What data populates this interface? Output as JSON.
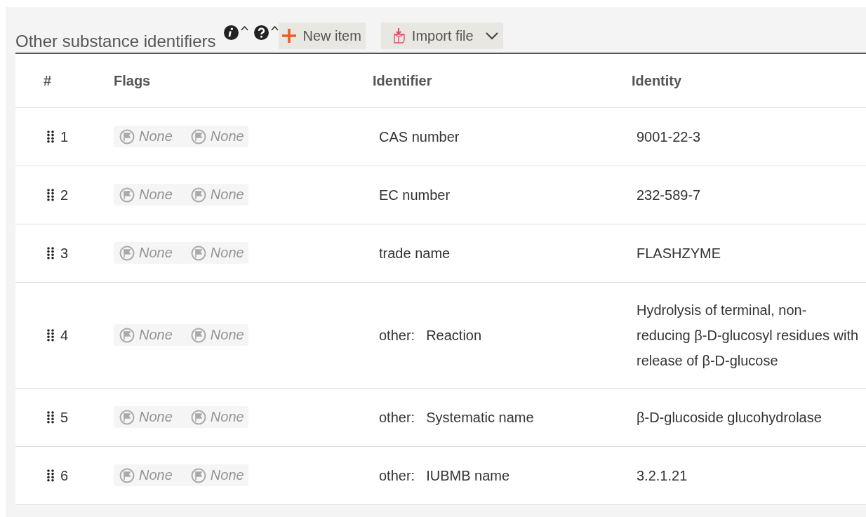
{
  "section": {
    "title": "Other substance identifiers"
  },
  "toolbar": {
    "new_item": "New item",
    "import_file": "Import file"
  },
  "table": {
    "columns": [
      "#",
      "Flags",
      "Identifier",
      "Identity"
    ],
    "rows": [
      {
        "number": "1",
        "flags": [
          {
            "label": "None",
            "disabled": true
          },
          {
            "label": "None",
            "disabled": true
          }
        ],
        "identifier": {
          "name": "CAS number"
        },
        "identity": "9001-22-3"
      },
      {
        "number": "2",
        "flags": [
          {
            "label": "None",
            "disabled": true
          },
          {
            "label": "None",
            "disabled": true
          }
        ],
        "identifier": {
          "name": "EC number"
        },
        "identity": "232-589-7"
      },
      {
        "number": "3",
        "flags": [
          {
            "label": "None",
            "disabled": true
          },
          {
            "label": "None",
            "disabled": true
          }
        ],
        "identifier": {
          "name": "trade name"
        },
        "identity": "FLASHZYME"
      },
      {
        "number": "4",
        "flags": [
          {
            "label": "None",
            "disabled": true
          },
          {
            "label": "None",
            "disabled": true
          }
        ],
        "identifier": {
          "qualifier": "other:",
          "name": "Reaction"
        },
        "identity": "Hydrolysis of terminal, non-reducing β-D-glucosyl residues with release of β-D-glucose"
      },
      {
        "number": "5",
        "flags": [
          {
            "label": "None",
            "disabled": true
          },
          {
            "label": "None",
            "disabled": true
          }
        ],
        "identifier": {
          "qualifier": "other:",
          "name": "Systematic name"
        },
        "identity": "β-D-glucoside glucohydrolase"
      },
      {
        "number": "6",
        "flags": [
          {
            "label": "None",
            "disabled": true
          },
          {
            "label": "None",
            "disabled": true
          }
        ],
        "identifier": {
          "qualifier": "other:",
          "name": "IUBMB name"
        },
        "identity": "3.2.1.21"
      }
    ]
  }
}
